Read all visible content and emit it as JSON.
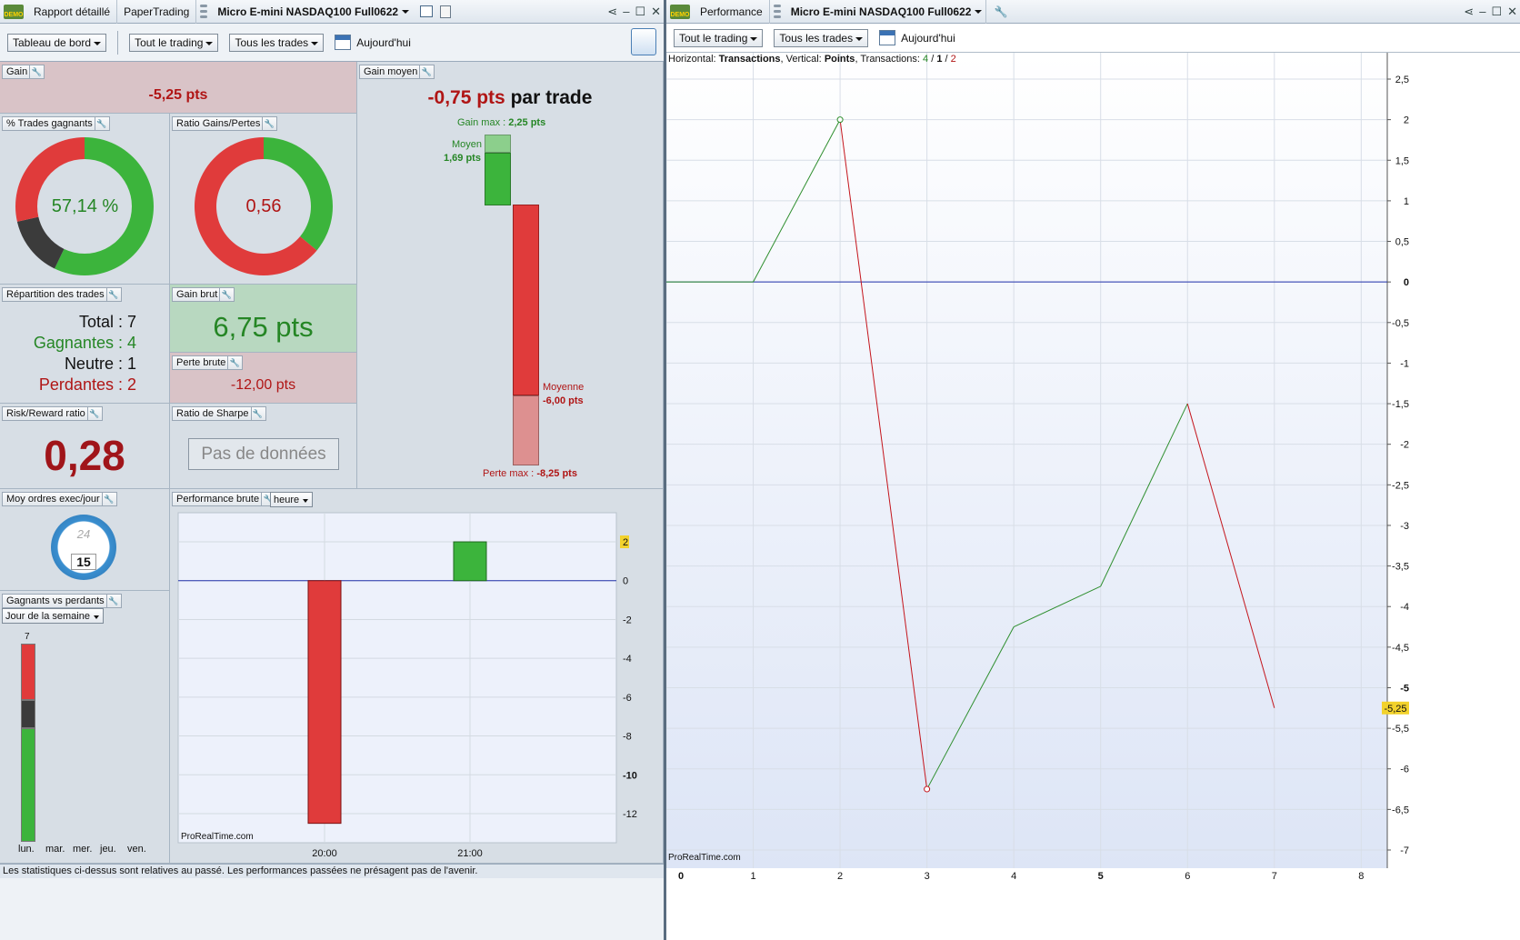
{
  "left_window": {
    "tabs": [
      "Rapport détaillé",
      "PaperTrading"
    ],
    "instrument": "Micro E-mini NASDAQ100 Full0622",
    "badge": "DEMO",
    "toolbar": {
      "view": "Tableau de bord",
      "trading": "Tout le trading",
      "trades": "Tous les trades",
      "period": "Aujourd'hui"
    }
  },
  "right_window": {
    "tab": "Performance",
    "instrument": "Micro E-mini NASDAQ100 Full0622",
    "badge": "DEMO",
    "toolbar": {
      "trading": "Tout le trading",
      "trades": "Tous les trades",
      "period": "Aujourd'hui"
    }
  },
  "gain": {
    "title": "Gain",
    "value": "-5,25 pts"
  },
  "win_rate": {
    "title": "% Trades gagnants",
    "value": "57,14 %",
    "segments": {
      "win": 4,
      "neutral": 1,
      "loss": 2
    }
  },
  "ratio": {
    "title": "Ratio Gains/Pertes",
    "value": "0,56",
    "gain": 6.75,
    "loss": 12.0
  },
  "gain_moyen": {
    "title": "Gain moyen",
    "value": "-0,75 pts",
    "suffix": "par trade",
    "max_gain_label": "Gain max :",
    "max_gain": "2,25 pts",
    "avg_win_label": "Moyen",
    "avg_win": "1,69 pts",
    "avg_loss_label": "Moyenne",
    "avg_loss": "-6,00 pts",
    "max_loss_label": "Perte max :",
    "max_loss": "-8,25 pts"
  },
  "repartition": {
    "title": "Répartition des trades",
    "total_label": "Total :",
    "total": "7",
    "win_label": "Gagnantes :",
    "win": "4",
    "neutral_label": "Neutre :",
    "neutral": "1",
    "loss_label": "Perdantes :",
    "loss": "2"
  },
  "gain_brut": {
    "title": "Gain brut",
    "value": "6,75 pts"
  },
  "perte_brute": {
    "title": "Perte brute",
    "value": "-12,00 pts"
  },
  "risk_reward": {
    "title": "Risk/Reward ratio",
    "value": "0,28"
  },
  "sharpe": {
    "title": "Ratio de Sharpe",
    "value": "Pas de données"
  },
  "moy_ordres": {
    "title": "Moy ordres exec/jour",
    "clock_top": "24",
    "clock_value": "15"
  },
  "gagnants_perdants": {
    "title": "Gagnants vs perdants",
    "grouping": "Jour de la semaine",
    "max": "7",
    "days": [
      "lun.",
      "mar.",
      "mer.",
      "jeu.",
      "ven."
    ],
    "monday": {
      "loss": 2,
      "neutral": 1,
      "win": 4
    }
  },
  "perf_brute": {
    "title": "Performance brute",
    "grouping": "heure",
    "watermark": "ProRealTime.com"
  },
  "footer": "Les statistiques ci-dessus sont relatives au passé. Les performances passées ne présagent pas de l'avenir.",
  "perf_header": {
    "l1": "Horizontal:",
    "l2": "Transactions",
    "l3": ", Vertical:",
    "l4": "Points",
    "l5": ", Transactions:",
    "n_win": "4",
    "sep1": " / ",
    "n_neutral": "1",
    "sep2": " / ",
    "n_loss": "2"
  },
  "perf_watermark": "ProRealTime.com",
  "chart_data": [
    {
      "type": "bar",
      "categories": [
        "20:00",
        "21:00"
      ],
      "values": [
        -12.5,
        2.0
      ],
      "ylim": [
        -13.5,
        3.5
      ],
      "yticks": [
        2,
        0,
        -2,
        -4,
        -6,
        -8,
        -10,
        -12
      ],
      "last_label": "2"
    },
    {
      "type": "line",
      "x": [
        0,
        1,
        2,
        3,
        4,
        5,
        6,
        7
      ],
      "y": [
        0,
        0,
        2,
        -6.25,
        -4.25,
        -3.75,
        -1.5,
        -5.25
      ],
      "xlim": [
        0,
        8.3
      ],
      "ylim": [
        -7,
        2.9
      ],
      "xticks": [
        0,
        1,
        2,
        3,
        4,
        5,
        6,
        7,
        8
      ],
      "yticks": [
        2.5,
        2,
        1.5,
        1,
        0.5,
        0,
        -0.5,
        -1,
        -1.5,
        -2,
        -2.5,
        -3,
        -3.5,
        -4,
        -4.5,
        -5,
        -5.5,
        -6,
        -6.5,
        -7
      ],
      "last_value": "-5,25",
      "colors": {
        "up": "#2f8f2f",
        "down": "#c4151c",
        "zero": "#2233aa"
      }
    }
  ],
  "colors": {
    "green": "#3cb43c",
    "red": "#e03b3b",
    "dark": "#3b3b3b",
    "value_red": "#b01515",
    "value_green": "#258625"
  }
}
